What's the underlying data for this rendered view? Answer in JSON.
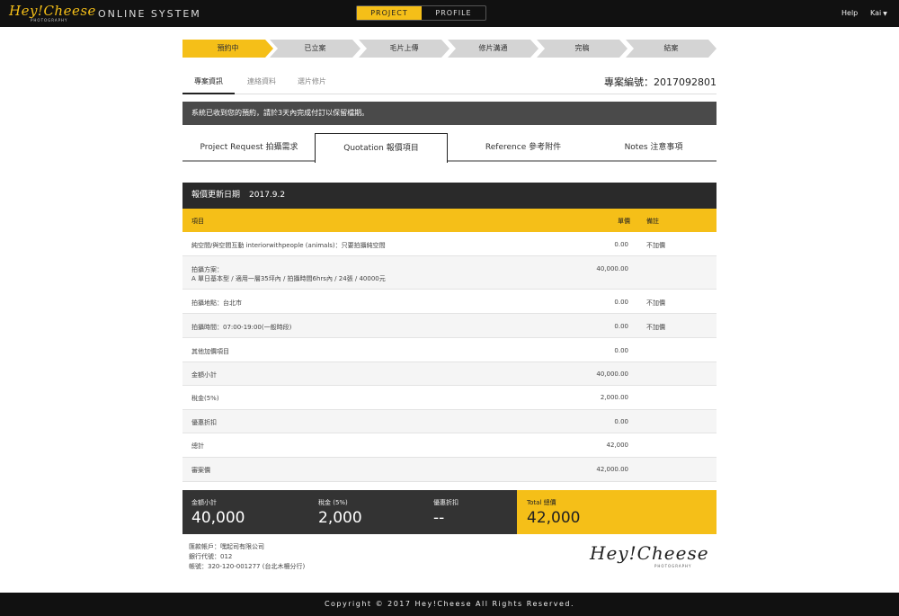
{
  "topbar": {
    "logo_text": "Hey!Cheese",
    "logo_sub": "PHOTOGRAPHY",
    "system_title": "ONLINE SYSTEM",
    "switch": {
      "active": "PROJECT",
      "inactive": "PROFILE"
    },
    "help": "Help",
    "user": "Kai",
    "user_caret": "▼"
  },
  "steps": [
    {
      "label": "預約中",
      "active": true
    },
    {
      "label": "已立案",
      "active": false
    },
    {
      "label": "毛片上傳",
      "active": false
    },
    {
      "label": "修片溝通",
      "active": false
    },
    {
      "label": "完稿",
      "active": false
    },
    {
      "label": "結案",
      "active": false
    }
  ],
  "subtabs": {
    "items": [
      "專案資訊",
      "連絡資料",
      "選片修片"
    ],
    "project_no": "專案編號：2017092801"
  },
  "notice": "系統已收到您的預約，請於3天內完成付訂以保留檔期。",
  "main_tabs": [
    "Project Request 拍攝需求",
    "Quotation 報價項目",
    "Reference 參考附件",
    "Notes 注意事項"
  ],
  "quote": {
    "head_label": "報價更新日期",
    "head_date": "2017.9.2",
    "columns": {
      "item": "項目",
      "price": "單價",
      "note": "備註"
    },
    "rows": [
      {
        "item": "純空間/與空間互動 interiorwithpeople (animals)：只要拍攝純空間",
        "item2": "",
        "price": "0.00",
        "note": "不加價"
      },
      {
        "item": "拍攝方案：",
        "item2": "A 單日基本型 / 適用一層35坪內 / 拍攝時間6hrs內 / 24張 / 40000元",
        "price": "40,000.00",
        "note": ""
      },
      {
        "item": "拍攝地點：台北市",
        "item2": "",
        "price": "0.00",
        "note": "不加價"
      },
      {
        "item": "拍攝時間：07:00-19:00(一般時段)",
        "item2": "",
        "price": "0.00",
        "note": "不加價"
      },
      {
        "item": "其他加價項目",
        "item2": "",
        "price": "0.00",
        "note": ""
      },
      {
        "item": "金額小計",
        "item2": "",
        "price": "40,000.00",
        "note": ""
      },
      {
        "item": "稅金(5%)",
        "item2": "",
        "price": "2,000.00",
        "note": ""
      },
      {
        "item": "優惠折扣",
        "item2": "",
        "price": "0.00",
        "note": ""
      },
      {
        "item": "總計",
        "item2": "",
        "price": "42,000",
        "note": ""
      },
      {
        "item": "審案價",
        "item2": "",
        "price": "42,000.00",
        "note": ""
      }
    ]
  },
  "summary": {
    "subtotal": {
      "label": "金額小計",
      "value": "40,000"
    },
    "tax": {
      "label": "稅金 (5%)",
      "value": "2,000"
    },
    "discount": {
      "label": "優惠折扣",
      "value": "--"
    },
    "total": {
      "label": "Total 總價",
      "value": "42,000"
    }
  },
  "bank": {
    "line1": "匯款帳戶：嘿起司有限公司",
    "line2": "銀行代號：012",
    "line3": "帳號：320-120-001277 (台北木柵分行)"
  },
  "bottom_logo": {
    "text": "Hey!Cheese",
    "sub": "PHOTOGRAPHY"
  },
  "footer": "Copyright © 2017 Hey!Cheese All Rights Reserved.",
  "colors": {
    "accent": "#f5bf18",
    "dark": "#111111",
    "notice_bg": "#4a4a4a"
  }
}
